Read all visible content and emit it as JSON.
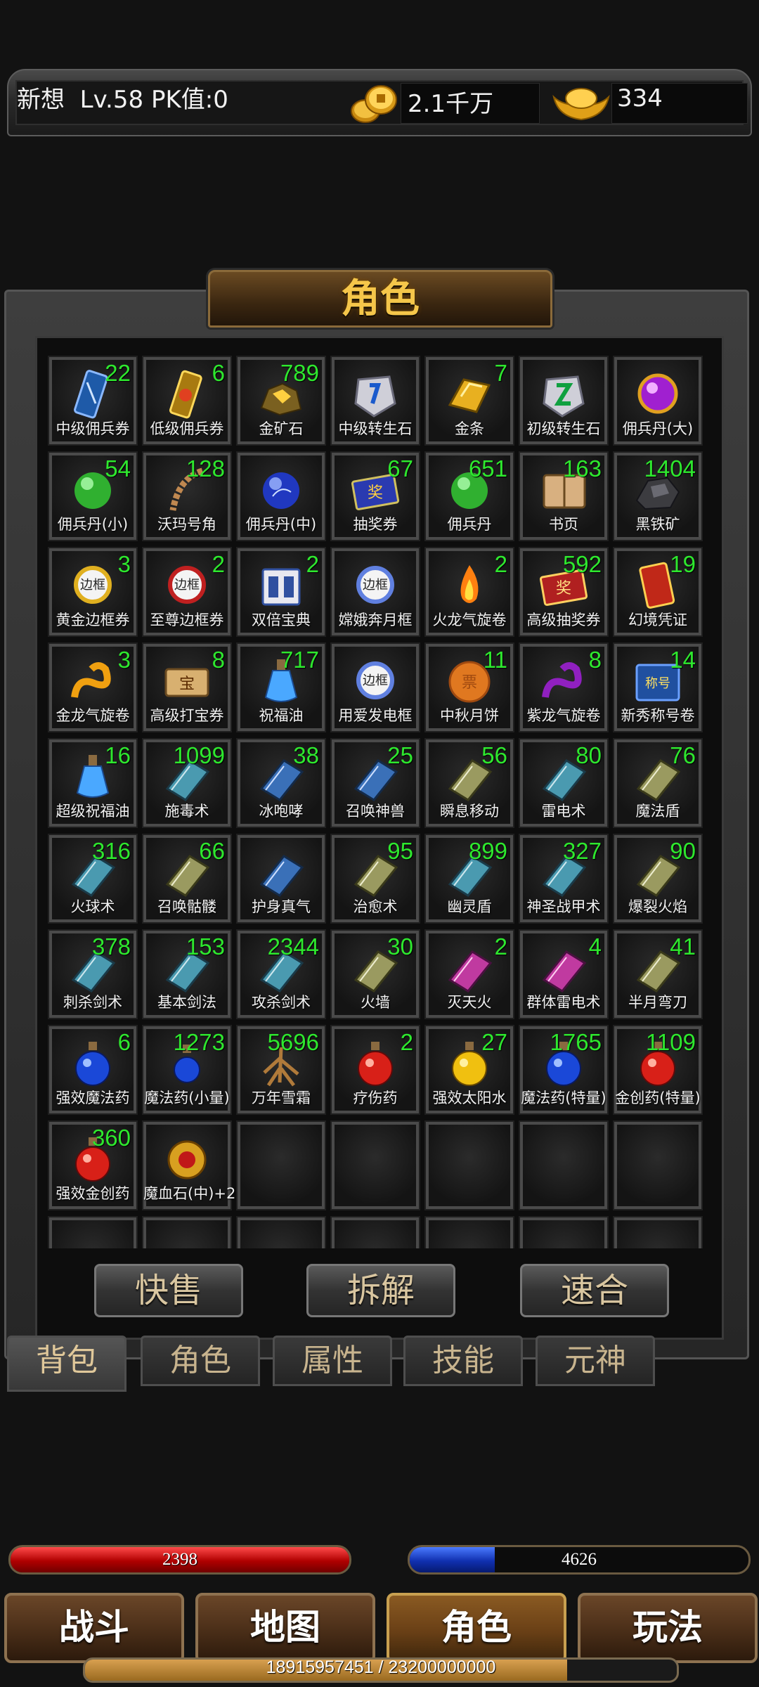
{
  "status": {
    "name": "新想",
    "level": "Lv.58",
    "pk": "PK值:0",
    "gold": "2.1千万",
    "ingot": "334"
  },
  "panel": {
    "title": "角色"
  },
  "items": [
    {
      "label": "中级佣兵券",
      "count": "22",
      "icon": "scroll-blue"
    },
    {
      "label": "低级佣兵券",
      "count": "6",
      "icon": "scroll-gold"
    },
    {
      "label": "金矿石",
      "count": "789",
      "icon": "ore"
    },
    {
      "label": "中级转生石",
      "count": "",
      "icon": "stone-blue"
    },
    {
      "label": "金条",
      "count": "7",
      "icon": "gold-bar"
    },
    {
      "label": "初级转生石",
      "count": "",
      "icon": "stone-green"
    },
    {
      "label": "佣兵丹(大)",
      "count": "",
      "icon": "orb-purple"
    },
    {
      "label": "佣兵丹(小)",
      "count": "54",
      "icon": "orb-green"
    },
    {
      "label": "沃玛号角",
      "count": "128",
      "icon": "horn"
    },
    {
      "label": "佣兵丹(中)",
      "count": "",
      "icon": "orb-blue"
    },
    {
      "label": "抽奖券",
      "count": "67",
      "icon": "ticket-blue"
    },
    {
      "label": "佣兵丹",
      "count": "651",
      "icon": "orb-green"
    },
    {
      "label": "书页",
      "count": "163",
      "icon": "pages"
    },
    {
      "label": "黑铁矿",
      "count": "1404",
      "icon": "ore-dark"
    },
    {
      "label": "黄金边框券",
      "count": "3",
      "icon": "frame-gold"
    },
    {
      "label": "至尊边框券",
      "count": "2",
      "icon": "frame-red"
    },
    {
      "label": "双倍宝典",
      "count": "2",
      "icon": "book-double"
    },
    {
      "label": "嫦娥奔月框",
      "count": "",
      "icon": "frame-blue"
    },
    {
      "label": "火龙气旋卷",
      "count": "2",
      "icon": "fire"
    },
    {
      "label": "高级抽奖券",
      "count": "592",
      "icon": "ticket-red"
    },
    {
      "label": "幻境凭证",
      "count": "19",
      "icon": "scroll-red"
    },
    {
      "label": "金龙气旋卷",
      "count": "3",
      "icon": "dragon-gold"
    },
    {
      "label": "高级打宝券",
      "count": "8",
      "icon": "scroll-treasure"
    },
    {
      "label": "祝福油",
      "count": "717",
      "icon": "bottle-blue"
    },
    {
      "label": "用爱发电框",
      "count": "",
      "icon": "frame-blue"
    },
    {
      "label": "中秋月饼",
      "count": "11",
      "icon": "mooncake"
    },
    {
      "label": "紫龙气旋卷",
      "count": "8",
      "icon": "dragon-purple"
    },
    {
      "label": "新秀称号卷",
      "count": "14",
      "icon": "title-scroll"
    },
    {
      "label": "超级祝福油",
      "count": "16",
      "icon": "bottle-blue"
    },
    {
      "label": "施毒术",
      "count": "1099",
      "icon": "book-teal"
    },
    {
      "label": "冰咆哮",
      "count": "38",
      "icon": "book-blue"
    },
    {
      "label": "召唤神兽",
      "count": "25",
      "icon": "book-blue"
    },
    {
      "label": "瞬息移动",
      "count": "56",
      "icon": "book-olive"
    },
    {
      "label": "雷电术",
      "count": "80",
      "icon": "book-teal"
    },
    {
      "label": "魔法盾",
      "count": "76",
      "icon": "book-olive"
    },
    {
      "label": "火球术",
      "count": "316",
      "icon": "book-teal"
    },
    {
      "label": "召唤骷髅",
      "count": "66",
      "icon": "book-olive"
    },
    {
      "label": "护身真气",
      "count": "",
      "icon": "book-blue"
    },
    {
      "label": "治愈术",
      "count": "95",
      "icon": "book-olive"
    },
    {
      "label": "幽灵盾",
      "count": "899",
      "icon": "book-teal"
    },
    {
      "label": "神圣战甲术",
      "count": "327",
      "icon": "book-teal"
    },
    {
      "label": "爆裂火焰",
      "count": "90",
      "icon": "book-olive"
    },
    {
      "label": "刺杀剑术",
      "count": "378",
      "icon": "book-teal"
    },
    {
      "label": "基本剑法",
      "count": "153",
      "icon": "book-teal"
    },
    {
      "label": "攻杀剑术",
      "count": "2344",
      "icon": "book-teal"
    },
    {
      "label": "火墙",
      "count": "30",
      "icon": "book-olive"
    },
    {
      "label": "灭天火",
      "count": "2",
      "icon": "book-pink"
    },
    {
      "label": "群体雷电术",
      "count": "4",
      "icon": "book-pink"
    },
    {
      "label": "半月弯刀",
      "count": "41",
      "icon": "book-olive"
    },
    {
      "label": "强效魔法药",
      "count": "6",
      "icon": "potion-blue"
    },
    {
      "label": "魔法药(小量)",
      "count": "1273",
      "icon": "potion-blue-small"
    },
    {
      "label": "万年雪霜",
      "count": "5696",
      "icon": "root"
    },
    {
      "label": "疗伤药",
      "count": "2",
      "icon": "potion-red"
    },
    {
      "label": "强效太阳水",
      "count": "27",
      "icon": "potion-yellow"
    },
    {
      "label": "魔法药(特量)",
      "count": "1765",
      "icon": "potion-blue"
    },
    {
      "label": "金创药(特量)",
      "count": "1109",
      "icon": "potion-red"
    },
    {
      "label": "强效金创药",
      "count": "360",
      "icon": "potion-red"
    },
    {
      "label": "魔血石(中)+2",
      "count": "",
      "icon": "blood-stone"
    },
    {
      "label": "",
      "count": "",
      "icon": ""
    },
    {
      "label": "",
      "count": "",
      "icon": ""
    },
    {
      "label": "",
      "count": "",
      "icon": ""
    },
    {
      "label": "",
      "count": "",
      "icon": ""
    },
    {
      "label": "",
      "count": "",
      "icon": ""
    },
    {
      "label": "",
      "count": "",
      "icon": ""
    },
    {
      "label": "",
      "count": "",
      "icon": ""
    },
    {
      "label": "",
      "count": "",
      "icon": ""
    },
    {
      "label": "",
      "count": "",
      "icon": ""
    },
    {
      "label": "",
      "count": "",
      "icon": ""
    },
    {
      "label": "",
      "count": "",
      "icon": ""
    },
    {
      "label": "",
      "count": "",
      "icon": ""
    }
  ],
  "actions": {
    "quick_sell": "快售",
    "dismantle": "拆解",
    "merge": "速合"
  },
  "tabs": [
    "背包",
    "角色",
    "属性",
    "技能",
    "元神"
  ],
  "active_tab": 0,
  "hp": {
    "value": "2398",
    "fill": 1.0
  },
  "mp": {
    "value": "4626",
    "fill": 0.25
  },
  "nav": [
    "战斗",
    "地图",
    "角色",
    "玩法"
  ],
  "active_nav": 2,
  "exp": {
    "text": "18915957451 / 23200000000",
    "fill": 0.815
  },
  "colors": {
    "count_text": "#2ee82e",
    "title_gold": "#f5c64a"
  }
}
